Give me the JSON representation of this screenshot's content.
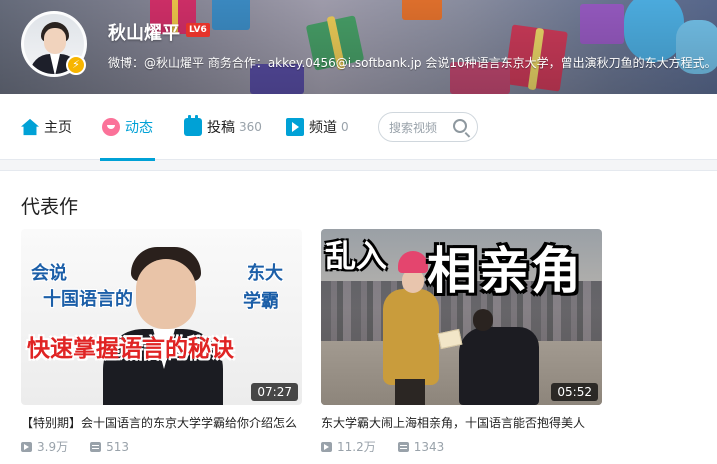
{
  "header": {
    "username": "秋山燿平",
    "level_badge": "LV6",
    "sign": "微博：@秋山燿平 商务合作：akkey.0456@i.softbank.jp 会说10种语言东京大学，曾出演秋刀鱼的东大方程式。"
  },
  "nav": {
    "items": [
      {
        "label": "主页",
        "icon": "home-icon",
        "count": ""
      },
      {
        "label": "动态",
        "icon": "dynamic-icon",
        "count": ""
      },
      {
        "label": "投稿",
        "icon": "upload-icon",
        "count": "360"
      },
      {
        "label": "频道",
        "icon": "channel-icon",
        "count": "0"
      }
    ],
    "active": "动态",
    "search_placeholder": "搜索视频"
  },
  "section": {
    "title": "代表作"
  },
  "videos": [
    {
      "title": "【特别期】会十国语言的东京大学学霸给你介绍怎么",
      "duration": "07:27",
      "views": "3.9万",
      "danmaku": "513",
      "thumb_text_1": "会说",
      "thumb_text_2": "十国语言的",
      "thumb_text_3": "东大",
      "thumb_text_4": "学霸",
      "thumb_text_5": "快速掌握语言的秘诀"
    },
    {
      "title": "东大学霸大闹上海相亲角，十国语言能否抱得美人",
      "duration": "05:52",
      "views": "11.2万",
      "danmaku": "1343",
      "thumb_text_1": "乱入",
      "thumb_text_2": "相亲角"
    }
  ],
  "colors": {
    "accent": "#00a1d6",
    "pink": "#fb7299",
    "level": "#e5332a"
  }
}
